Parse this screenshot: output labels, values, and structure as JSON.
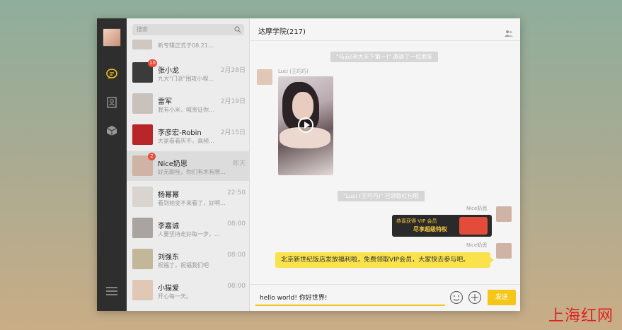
{
  "search": {
    "placeholder": "搜索"
  },
  "list": {
    "top_snippet": "新专辑正式于08.21...",
    "items": [
      {
        "name": "张小龙",
        "time": "2月28日",
        "preview": "九大\"门派\"围攻小程...",
        "badge": "10",
        "avatar_color": "#3b3b3b"
      },
      {
        "name": "雷军",
        "time": "2月19日",
        "preview": "我有小米，喊贵证你...",
        "badge": "",
        "avatar_color": "#c9c1bb"
      },
      {
        "name": "李彦宏-Robin",
        "time": "2月15日",
        "preview": "大家看看庆不，高频...",
        "badge": "",
        "avatar_color": "#b8252a"
      },
      {
        "name": "Nice奶思",
        "time": "昨天",
        "preview": "好无聊哇，你们有木有想...",
        "badge": "2",
        "avatar_color": "#cfb3a4"
      },
      {
        "name": "杨幂幂",
        "time": "22:50",
        "preview": "看到她变不来看了，好啊...",
        "badge": "",
        "avatar_color": "#d9d4cf"
      },
      {
        "name": "李嘉诚",
        "time": "08:00",
        "preview": "人要坚持走好每一步，...",
        "badge": "",
        "avatar_color": "#a9a4a0"
      },
      {
        "name": "刘强东",
        "time": "08:00",
        "preview": "祝福了，祝福我们吧",
        "badge": "",
        "avatar_color": "#c3b79a"
      },
      {
        "name": "小猫爱",
        "time": "08:00",
        "preview": "开心每一天。",
        "badge": "",
        "avatar_color": "#e1c7b6"
      }
    ]
  },
  "chat": {
    "title": "达摩学院(217)",
    "sys_msg_1": "\"马云(老大天下第一)\" 邀请了一位朋友",
    "sender_1": "Luci (王巧巧)",
    "sys_msg_2": "\"Luci (王巧巧)\" 已领取红包哦",
    "sender_2": "Nice奶思",
    "vip_line1": "恭喜获得  VIP 会员",
    "vip_line2": "尽享超级特权",
    "sender_3": "Nice奶思",
    "bubble_text": "北京新世纪饭店发放福利啦，免费领取VIP会员，大家快去参与吧。"
  },
  "composer": {
    "input_value": "hello world! 你好世界!",
    "send_label": "发送"
  },
  "watermark": "上海红网"
}
